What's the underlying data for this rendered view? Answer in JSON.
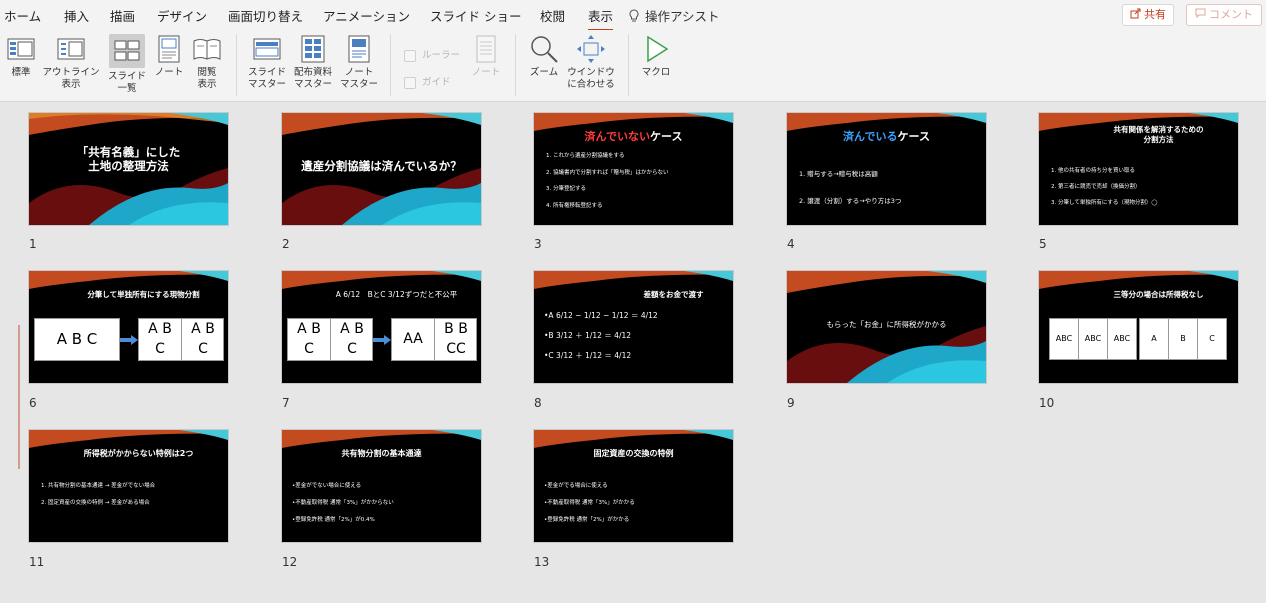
{
  "tabs": [
    "ホーム",
    "挿入",
    "描画",
    "デザイン",
    "画面切り替え",
    "アニメーション",
    "スライド ショー",
    "校閲",
    "表示",
    "操作アシスト"
  ],
  "share_label": "共有",
  "comment_label": "コメント",
  "ribbon": {
    "normal": "標準",
    "outline": [
      "アウトライン",
      "表示"
    ],
    "sorter": [
      "スライド",
      "一覧"
    ],
    "notes": "ノート",
    "reading": [
      "閲覧",
      "表示"
    ],
    "slide_master": [
      "スライド",
      "マスター"
    ],
    "handout_master": [
      "配布資料",
      "マスター"
    ],
    "notes_master": [
      "ノート",
      "マスター"
    ],
    "ruler": "ルーラー",
    "guides": "ガイド",
    "notes2": "ノート",
    "zoom": "ズーム",
    "fit": [
      "ウインドウ",
      "に合わせる"
    ],
    "macro": "マクロ"
  },
  "slides": [
    {
      "n": "1",
      "title": [
        "「共有名義」にした",
        "土地の整理方法"
      ]
    },
    {
      "n": "2",
      "title": "遺産分割協議は済んでいるか？"
    },
    {
      "n": "3",
      "title_a": "済んでいない",
      "title_b": "ケース",
      "items": [
        "1. これから遺産分割協議をする",
        "2. 協議書内で分割すれば「贈与税」はかからない",
        "3. 分筆登記する",
        "4. 所有権移転登記する"
      ]
    },
    {
      "n": "4",
      "title_a": "済んでいる",
      "title_b": "ケース",
      "items": [
        "1. 贈与する→贈与税は高額",
        "2. 譲渡（分割）する→やり方は3つ"
      ]
    },
    {
      "n": "5",
      "title": [
        "共有関係を解消するための",
        "分割方法"
      ],
      "items": [
        "1. 他の共有者の持ち分を買い取る",
        "2. 第三者に競売で売却（換価分割）",
        "3. 分筆して単独所有にする（現物分割）◯"
      ]
    },
    {
      "n": "6",
      "title": "分筆して単独所有にする現物分割",
      "box1": "A B C",
      "box2": [
        "A",
        "B",
        "C",
        "A",
        "B",
        "C"
      ]
    },
    {
      "n": "7",
      "title": "A 6/12　BとC 3/12ずつだと不公平",
      "box1": [
        "A",
        "B",
        "C",
        "A",
        "B",
        "C"
      ],
      "box2": [
        "A",
        "A",
        "B",
        "B",
        "C",
        "C"
      ]
    },
    {
      "n": "8",
      "title": "差額をお金で渡す",
      "items": [
        "•A  6/12 − 1/12 − 1/12 ＝ 4/12",
        "•B  3/12 ＋ 1/12 ＝ 4/12",
        "•C  3/12 ＋ 1/12 ＝ 4/12"
      ]
    },
    {
      "n": "9",
      "title": "もらった「お金」に所得税がかかる"
    },
    {
      "n": "10",
      "title": "三等分の場合は所得税なし",
      "cells1": [
        "ABC",
        "ABC",
        "ABC"
      ],
      "cells2": [
        "A",
        "B",
        "C"
      ]
    },
    {
      "n": "11",
      "title": "所得税がかからない特例は2つ",
      "items": [
        "1. 共有物分割の基本通達 → 差金がでない場合",
        "2. 固定資産の交換の特例 → 差金がある場合"
      ]
    },
    {
      "n": "12",
      "title": "共有物分割の基本通達",
      "items": [
        "•差金がでない場合に使える",
        "•不動産取得税 通常「3%」がかからない",
        "•登録免許税 通常「2%」が0.4%"
      ]
    },
    {
      "n": "13",
      "title": "固定資産の交換の特例",
      "items": [
        "•差金がでる場合に使える",
        "•不動産取得税 通常「3%」がかかる",
        "•登録免許税 通常「2%」がかかる"
      ]
    }
  ],
  "colors": {
    "accent": "#c43e1c",
    "red_text": "#ff3b3b",
    "blue_text": "#3aa0ff"
  }
}
